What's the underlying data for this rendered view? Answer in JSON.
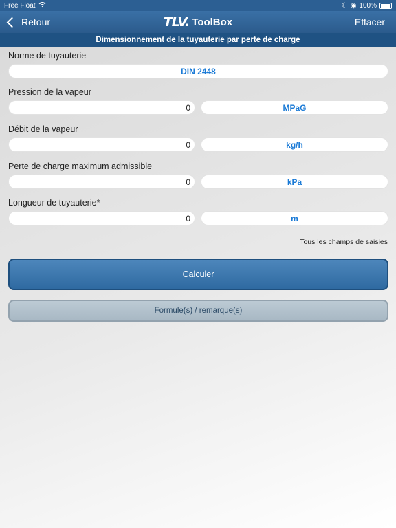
{
  "status": {
    "carrier": "Free Float",
    "battery": "100%"
  },
  "nav": {
    "back_label": "Retour",
    "logo_tlv": "TLV.",
    "logo_toolbox": "ToolBox",
    "clear_label": "Effacer"
  },
  "page_title": "Dimensionnement de la tuyauterie par perte de charge",
  "fields": {
    "pipe_norm": {
      "label": "Norme de tuyauterie",
      "value": "DIN 2448"
    },
    "steam_pressure": {
      "label": "Pression de la vapeur",
      "value": "0",
      "unit": "MPaG"
    },
    "steam_flow": {
      "label": "Débit de la vapeur",
      "value": "0",
      "unit": "kg/h"
    },
    "max_pressure_loss": {
      "label": "Perte de charge maximum admissible",
      "value": "0",
      "unit": "kPa"
    },
    "pipe_length": {
      "label": "Longueur de tuyauterie*",
      "value": "0",
      "unit": "m"
    }
  },
  "all_fields_link": "Tous les champs de saisies",
  "buttons": {
    "calculate": "Calculer",
    "formulas": "Formule(s) / remarque(s)"
  },
  "colors": {
    "navbar": "#2b5b8c",
    "subheader": "#1f5283",
    "accent_text": "#1a7ad6"
  }
}
